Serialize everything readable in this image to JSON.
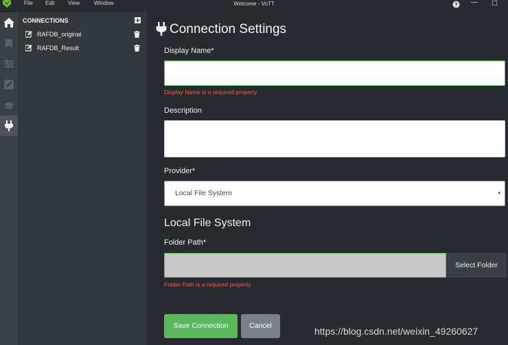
{
  "window": {
    "title": "Welcome - VoTT",
    "menu": [
      "File",
      "Edit",
      "View",
      "Window"
    ],
    "help_glyph": "?",
    "minimize_glyph": "—",
    "maximize_glyph": "☐"
  },
  "rail": {
    "items": [
      "home-icon",
      "bookmark-icon",
      "sliders-icon",
      "edit-square-icon",
      "graduation-cap-icon",
      "plug-icon"
    ],
    "active": "plug-icon"
  },
  "connections": {
    "header": "CONNECTIONS",
    "items": [
      {
        "label": "RAFDB_original"
      },
      {
        "label": "RAFDB_Result"
      }
    ]
  },
  "form": {
    "title": "Connection Settings",
    "display_name_label": "Display Name*",
    "display_name_value": "",
    "display_name_error": "Display Name is a required property",
    "description_label": "Description",
    "description_value": "",
    "provider_label": "Provider*",
    "provider_value": "Local File System",
    "provider_caret": "▾",
    "section_title": "Local File System",
    "folder_path_label": "Folder Path*",
    "folder_path_value": "",
    "select_folder_label": "Select Folder",
    "folder_path_error": "Folder Path is a required property",
    "save_label": "Save Connection",
    "cancel_label": "Cancel"
  },
  "watermark": "https://blog.csdn.net/weixin_49260627",
  "colors": {
    "background": "#272b30",
    "panel": "#32373c",
    "rail": "#3a3f44",
    "success": "#5cb85c",
    "danger": "#e8604f",
    "secondary": "#7a8288"
  }
}
